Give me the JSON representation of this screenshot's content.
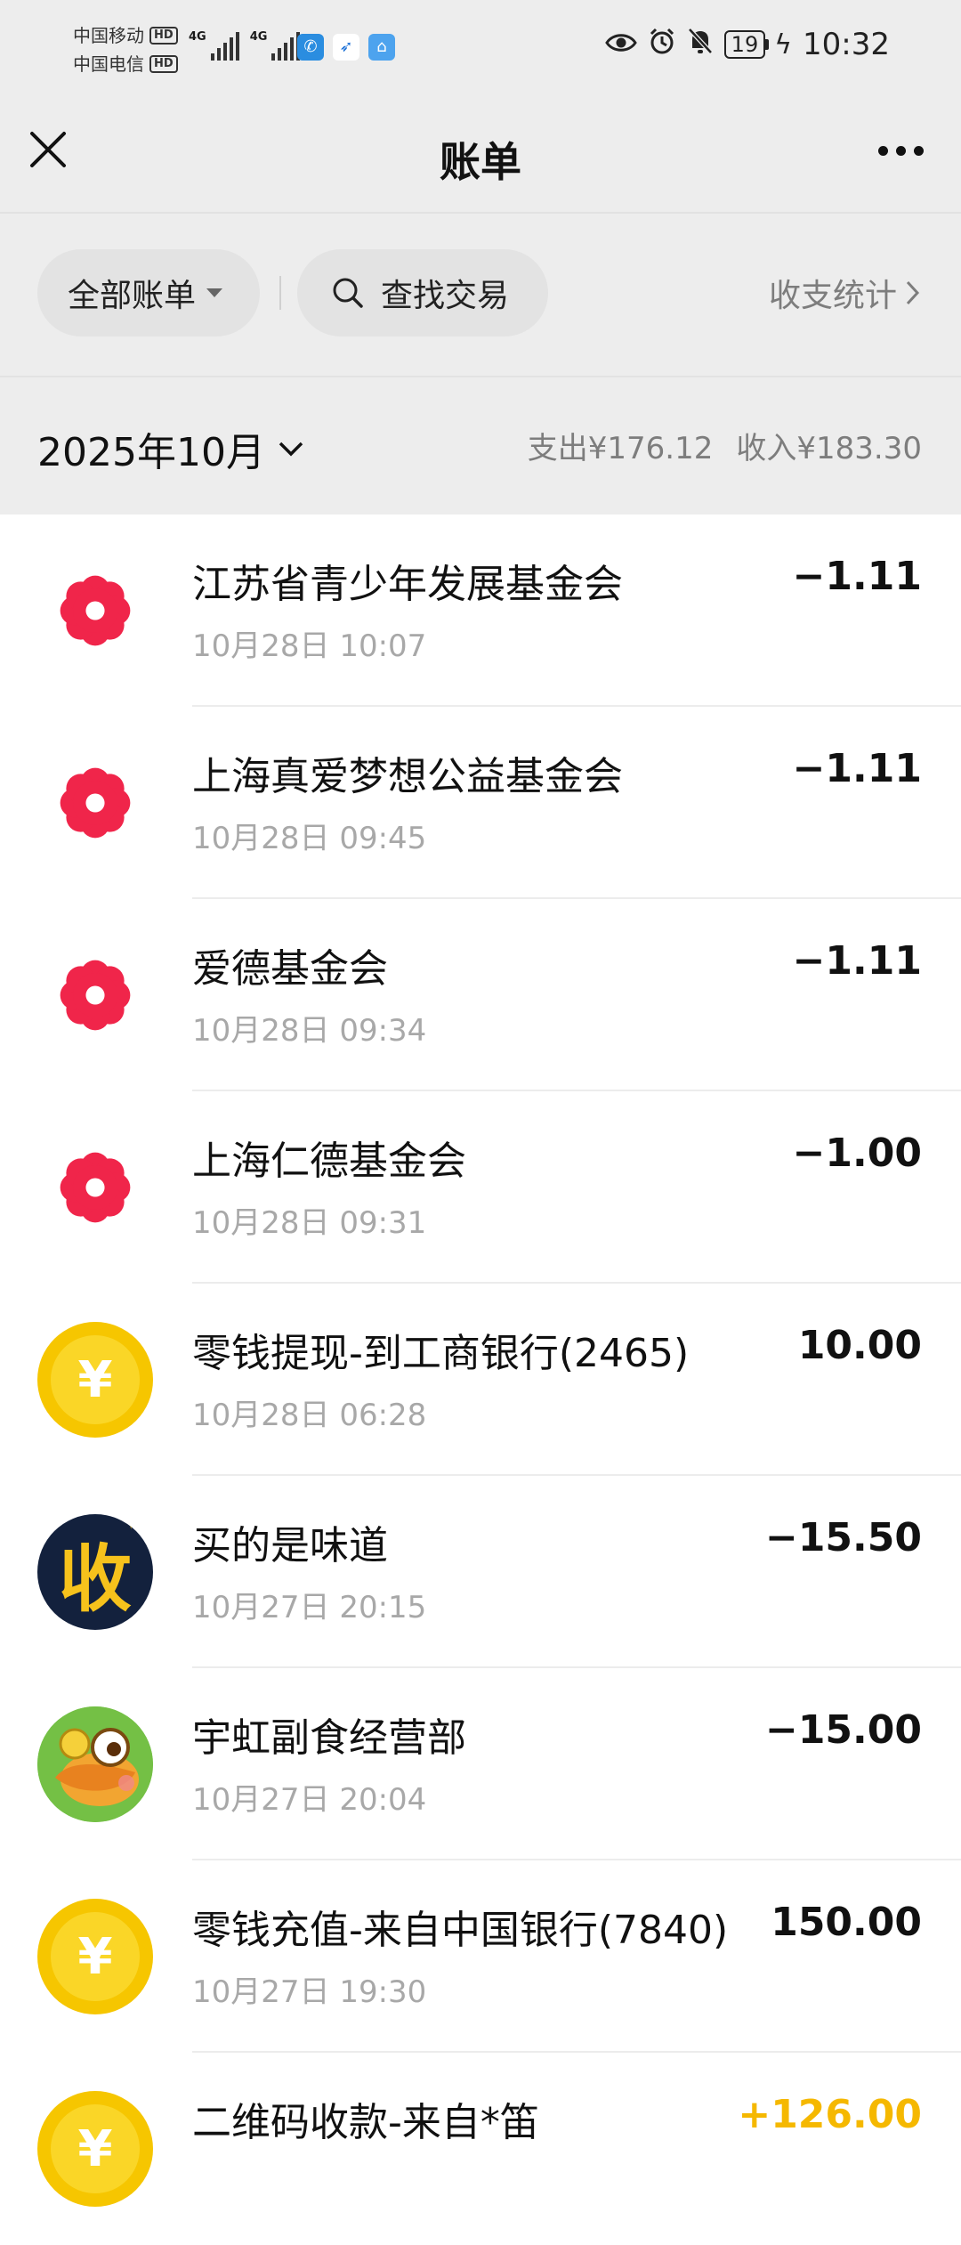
{
  "status_bar": {
    "carrier1": "中国移动",
    "carrier2": "中国电信",
    "hd_badge": "HD",
    "network1": "4G",
    "network2": "4G",
    "battery_level": "19",
    "time": "10:32",
    "app_icons": [
      "app-icon-blue",
      "app-icon-bird",
      "app-icon-tower"
    ]
  },
  "nav": {
    "title": "账单",
    "close_icon": "close-icon",
    "more_icon": "more-icon"
  },
  "filters": {
    "all_bills_label": "全部账单",
    "search_label": "查找交易",
    "stats_label": "收支统计"
  },
  "month": {
    "label": "2025年10月",
    "expense_label": "支出¥176.12",
    "income_label": "收入¥183.30"
  },
  "transactions": [
    {
      "name": "江苏省青少年发展基金会",
      "time": "10月28日 10:07",
      "amount": "−1.11",
      "icon": "red-flower-icon"
    },
    {
      "name": "上海真爱梦想公益基金会",
      "time": "10月28日 09:45",
      "amount": "−1.11",
      "icon": "red-flower-icon"
    },
    {
      "name": "爱德基金会",
      "time": "10月28日 09:34",
      "amount": "−1.11",
      "icon": "red-flower-icon"
    },
    {
      "name": "上海仁德基金会",
      "time": "10月28日 09:31",
      "amount": "−1.00",
      "icon": "red-flower-icon"
    },
    {
      "name": "零钱提现-到工商银行(2465)",
      "time": "10月28日 06:28",
      "amount": "10.00",
      "icon": "yuan-coin-icon"
    },
    {
      "name": "买的是味道",
      "time": "10月27日 20:15",
      "amount": "−15.50",
      "icon": "收",
      "icon_name": "collect-money-icon"
    },
    {
      "name": "宇虹副食经营部",
      "time": "10月27日 20:04",
      "amount": "−15.00",
      "icon": "cartoon-bird-avatar"
    },
    {
      "name": "零钱充值-来自中国银行(7840)",
      "time": "10月27日 19:30",
      "amount": "150.00",
      "icon": "yuan-coin-icon"
    },
    {
      "name": "二维码收款-来自*笛",
      "time": "",
      "amount": "+126.00",
      "icon": "yuan-coin-icon"
    }
  ],
  "colors": {
    "header_bg": "#ededed",
    "income": "#f5b800",
    "flower_red": "#f0254a",
    "coin_yellow": "#f6c600"
  }
}
